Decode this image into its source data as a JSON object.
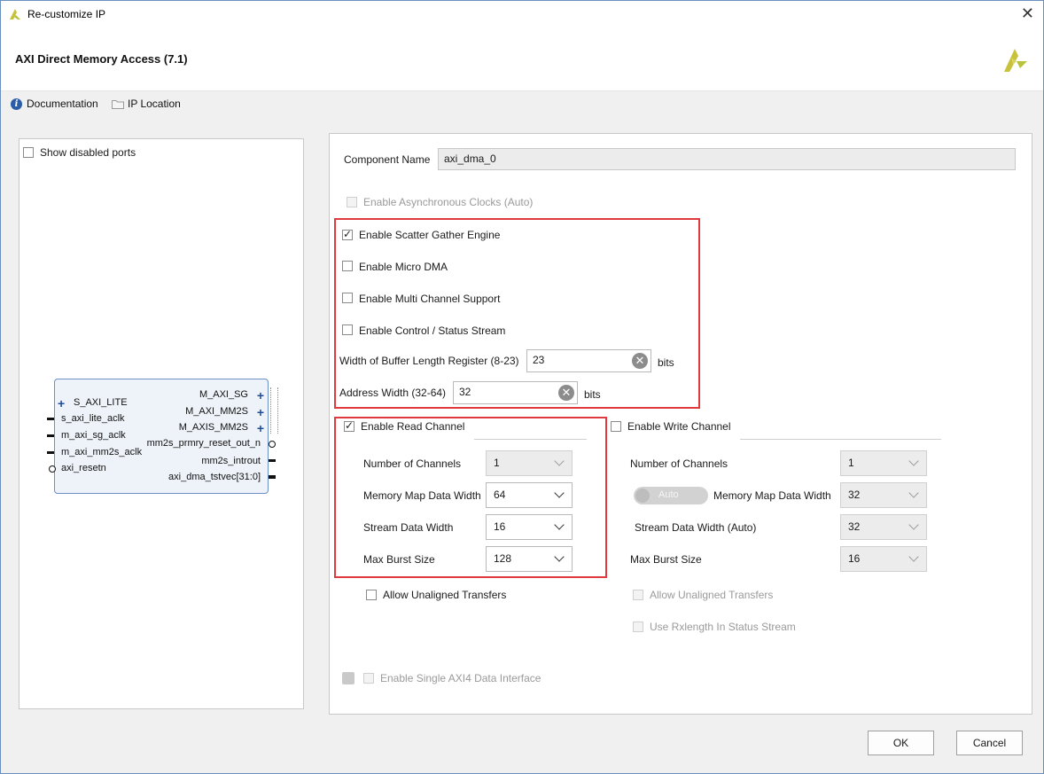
{
  "window": {
    "title": "Re-customize IP"
  },
  "header": {
    "ip_title": "AXI Direct Memory Access (7.1)"
  },
  "links": {
    "documentation": "Documentation",
    "ip_location": "IP Location"
  },
  "left_panel": {
    "show_disabled_ports": "Show disabled ports",
    "block": {
      "left_pins": [
        "S_AXI_LITE",
        "s_axi_lite_aclk",
        "m_axi_sg_aclk",
        "m_axi_mm2s_aclk",
        "axi_resetn"
      ],
      "right_pins": [
        "M_AXI_SG",
        "M_AXI_MM2S",
        "M_AXIS_MM2S",
        "mm2s_prmry_reset_out_n",
        "mm2s_introut",
        "axi_dma_tstvec[31:0]"
      ]
    }
  },
  "config": {
    "component_name_label": "Component Name",
    "component_name_value": "axi_dma_0",
    "async_clocks": "Enable Asynchronous Clocks (Auto)",
    "scatter_gather": "Enable Scatter Gather Engine",
    "micro_dma": "Enable Micro DMA",
    "multi_channel": "Enable Multi Channel Support",
    "control_status": "Enable Control / Status Stream",
    "buffer_length_label": "Width of Buffer Length Register (8-23)",
    "buffer_length_value": "23",
    "buffer_length_unit": "bits",
    "address_width_label": "Address Width (32-64)",
    "address_width_value": "32",
    "address_width_unit": "bits",
    "read_channel": {
      "title": "Enable Read Channel",
      "num_channels_label": "Number of Channels",
      "num_channels_value": "1",
      "mm_data_width_label": "Memory Map Data Width",
      "mm_data_width_value": "64",
      "stream_data_width_label": "Stream Data Width",
      "stream_data_width_value": "16",
      "max_burst_label": "Max Burst Size",
      "max_burst_value": "128",
      "allow_unaligned": "Allow Unaligned Transfers"
    },
    "write_channel": {
      "title": "Enable Write Channel",
      "num_channels_label": "Number of Channels",
      "num_channels_value": "1",
      "auto_toggle": "Auto",
      "mm_data_width_label": "Memory Map Data Width",
      "mm_data_width_value": "32",
      "stream_data_width_label": "Stream Data Width (Auto)",
      "stream_data_width_value": "32",
      "max_burst_label": "Max Burst Size",
      "max_burst_value": "16",
      "allow_unaligned": "Allow Unaligned Transfers",
      "use_rxlength": "Use Rxlength In Status Stream"
    },
    "single_axi4": "Enable Single AXI4 Data Interface"
  },
  "buttons": {
    "ok": "OK",
    "cancel": "Cancel"
  },
  "colors": {
    "highlight_red": "#e0393e",
    "logo_yellow": "#c8c23a"
  },
  "icons": {
    "app": "xilinx-logo-icon",
    "info": "info-icon",
    "folder": "folder-icon",
    "close": "close-icon"
  }
}
